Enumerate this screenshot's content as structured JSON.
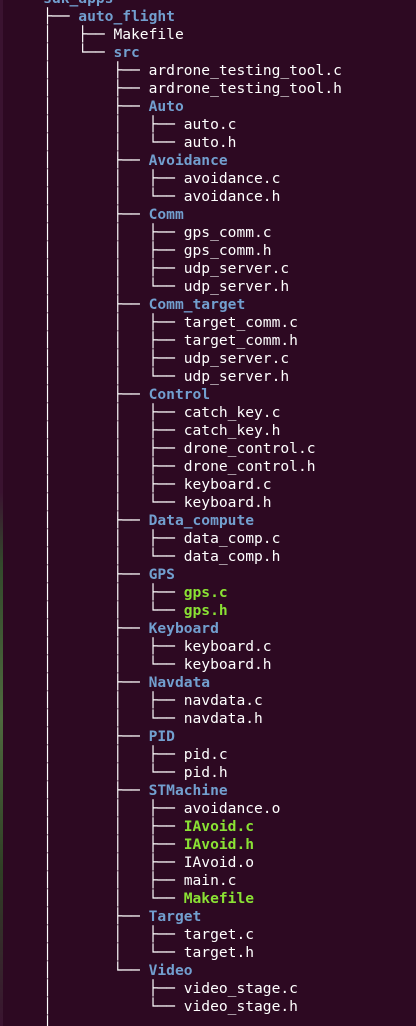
{
  "tree": [
    {
      "prefix": "└── ",
      "name": "sdk_apps",
      "type": "dir"
    },
    {
      "prefix": "    ├── ",
      "name": "auto_flight",
      "type": "dir"
    },
    {
      "prefix": "    │   ├── ",
      "name": "Makefile",
      "type": "file"
    },
    {
      "prefix": "    │   └── ",
      "name": "src",
      "type": "dir"
    },
    {
      "prefix": "    │       ├── ",
      "name": "ardrone_testing_tool.c",
      "type": "file"
    },
    {
      "prefix": "    │       ├── ",
      "name": "ardrone_testing_tool.h",
      "type": "file"
    },
    {
      "prefix": "    │       ├── ",
      "name": "Auto",
      "type": "dir"
    },
    {
      "prefix": "    │       │   ├── ",
      "name": "auto.c",
      "type": "file"
    },
    {
      "prefix": "    │       │   └── ",
      "name": "auto.h",
      "type": "file"
    },
    {
      "prefix": "    │       ├── ",
      "name": "Avoidance",
      "type": "dir"
    },
    {
      "prefix": "    │       │   ├── ",
      "name": "avoidance.c",
      "type": "file"
    },
    {
      "prefix": "    │       │   └── ",
      "name": "avoidance.h",
      "type": "file"
    },
    {
      "prefix": "    │       ├── ",
      "name": "Comm",
      "type": "dir"
    },
    {
      "prefix": "    │       │   ├── ",
      "name": "gps_comm.c",
      "type": "file"
    },
    {
      "prefix": "    │       │   ├── ",
      "name": "gps_comm.h",
      "type": "file"
    },
    {
      "prefix": "    │       │   ├── ",
      "name": "udp_server.c",
      "type": "file"
    },
    {
      "prefix": "    │       │   └── ",
      "name": "udp_server.h",
      "type": "file"
    },
    {
      "prefix": "    │       ├── ",
      "name": "Comm_target",
      "type": "dir"
    },
    {
      "prefix": "    │       │   ├── ",
      "name": "target_comm.c",
      "type": "file"
    },
    {
      "prefix": "    │       │   ├── ",
      "name": "target_comm.h",
      "type": "file"
    },
    {
      "prefix": "    │       │   ├── ",
      "name": "udp_server.c",
      "type": "file"
    },
    {
      "prefix": "    │       │   └── ",
      "name": "udp_server.h",
      "type": "file"
    },
    {
      "prefix": "    │       ├── ",
      "name": "Control",
      "type": "dir"
    },
    {
      "prefix": "    │       │   ├── ",
      "name": "catch_key.c",
      "type": "file"
    },
    {
      "prefix": "    │       │   ├── ",
      "name": "catch_key.h",
      "type": "file"
    },
    {
      "prefix": "    │       │   ├── ",
      "name": "drone_control.c",
      "type": "file"
    },
    {
      "prefix": "    │       │   ├── ",
      "name": "drone_control.h",
      "type": "file"
    },
    {
      "prefix": "    │       │   ├── ",
      "name": "keyboard.c",
      "type": "file"
    },
    {
      "prefix": "    │       │   └── ",
      "name": "keyboard.h",
      "type": "file"
    },
    {
      "prefix": "    │       ├── ",
      "name": "Data_compute",
      "type": "dir"
    },
    {
      "prefix": "    │       │   ├── ",
      "name": "data_comp.c",
      "type": "file"
    },
    {
      "prefix": "    │       │   └── ",
      "name": "data_comp.h",
      "type": "file"
    },
    {
      "prefix": "    │       ├── ",
      "name": "GPS",
      "type": "dir"
    },
    {
      "prefix": "    │       │   ├── ",
      "name": "gps.c",
      "type": "exec"
    },
    {
      "prefix": "    │       │   └── ",
      "name": "gps.h",
      "type": "exec"
    },
    {
      "prefix": "    │       ├── ",
      "name": "Keyboard",
      "type": "dir"
    },
    {
      "prefix": "    │       │   ├── ",
      "name": "keyboard.c",
      "type": "file"
    },
    {
      "prefix": "    │       │   └── ",
      "name": "keyboard.h",
      "type": "file"
    },
    {
      "prefix": "    │       ├── ",
      "name": "Navdata",
      "type": "dir"
    },
    {
      "prefix": "    │       │   ├── ",
      "name": "navdata.c",
      "type": "file"
    },
    {
      "prefix": "    │       │   └── ",
      "name": "navdata.h",
      "type": "file"
    },
    {
      "prefix": "    │       ├── ",
      "name": "PID",
      "type": "dir"
    },
    {
      "prefix": "    │       │   ├── ",
      "name": "pid.c",
      "type": "file"
    },
    {
      "prefix": "    │       │   └── ",
      "name": "pid.h",
      "type": "file"
    },
    {
      "prefix": "    │       ├── ",
      "name": "STMachine",
      "type": "dir"
    },
    {
      "prefix": "    │       │   ├── ",
      "name": "avoidance.o",
      "type": "file"
    },
    {
      "prefix": "    │       │   ├── ",
      "name": "IAvoid.c",
      "type": "exec"
    },
    {
      "prefix": "    │       │   ├── ",
      "name": "IAvoid.h",
      "type": "exec"
    },
    {
      "prefix": "    │       │   ├── ",
      "name": "IAvoid.o",
      "type": "file"
    },
    {
      "prefix": "    │       │   ├── ",
      "name": "main.c",
      "type": "file"
    },
    {
      "prefix": "    │       │   └── ",
      "name": "Makefile",
      "type": "exec"
    },
    {
      "prefix": "    │       ├── ",
      "name": "Target",
      "type": "dir"
    },
    {
      "prefix": "    │       │   ├── ",
      "name": "target.c",
      "type": "file"
    },
    {
      "prefix": "    │       │   └── ",
      "name": "target.h",
      "type": "file"
    },
    {
      "prefix": "    │       └── ",
      "name": "Video",
      "type": "dir"
    },
    {
      "prefix": "    │           ├── ",
      "name": "video_stage.c",
      "type": "file"
    },
    {
      "prefix": "    │           └── ",
      "name": "video_stage.h",
      "type": "file"
    },
    {
      "prefix": "    │",
      "name": "",
      "type": "file"
    }
  ]
}
